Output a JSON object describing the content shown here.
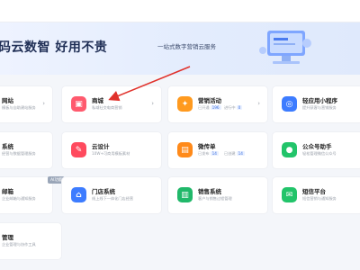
{
  "header": {
    "brand": "码云数智  好用不贵",
    "tagline": "一站式数字营销云服务"
  },
  "cards": {
    "website": {
      "title": "网站",
      "sub": "模板与自助建站服务"
    },
    "mall": {
      "title": "商城",
      "sub": "私域社交电商营销"
    },
    "marketing": {
      "title": "营销活动",
      "stat1_label": "已开通",
      "stat1_value": "196",
      "stat2_label": "进行中",
      "stat2_value": "0"
    },
    "miniprogram": {
      "title": "轻应用小程序",
      "sub": "提升获客与营销服务"
    },
    "system": {
      "title": "系统",
      "sub": "经营与数据管理服务"
    },
    "cloud_design": {
      "title": "云设计",
      "sub": "10W+可商用模板素材"
    },
    "flyer": {
      "title": "微传单",
      "stat1_label": "已发布",
      "stat1_value": "14",
      "stat2_label": "已创建",
      "stat2_value": "14"
    },
    "official_account": {
      "title": "公众号助手",
      "sub": "轻松管理微信公众号"
    },
    "mailbox": {
      "title": "邮箱",
      "sub": "企业邮箱与通知服务",
      "badge": "AI功能"
    },
    "store": {
      "title": "门店系统",
      "sub": "线上线下一体化门店经营"
    },
    "sales": {
      "title": "销售系统",
      "sub": "客户与销售过程管理"
    },
    "sms": {
      "title": "短信平台",
      "sub": "短信营销与通知服务"
    },
    "management": {
      "title": "管理",
      "sub": "企业管理与协作工具"
    }
  },
  "colors": {
    "mall_tile": "#ff5a6e",
    "marketing_tile": "#ff9a1f",
    "miniprogram_tile": "#3d7cff",
    "cloud_design_tile": "#ff4a5e",
    "flyer_tile": "#ff8a1a",
    "official_account_tile": "#22c46a",
    "store_tile": "#3d7cff",
    "sales_tile": "#21b86a",
    "sms_tile": "#22c46a",
    "arrow": "#e0312b"
  }
}
